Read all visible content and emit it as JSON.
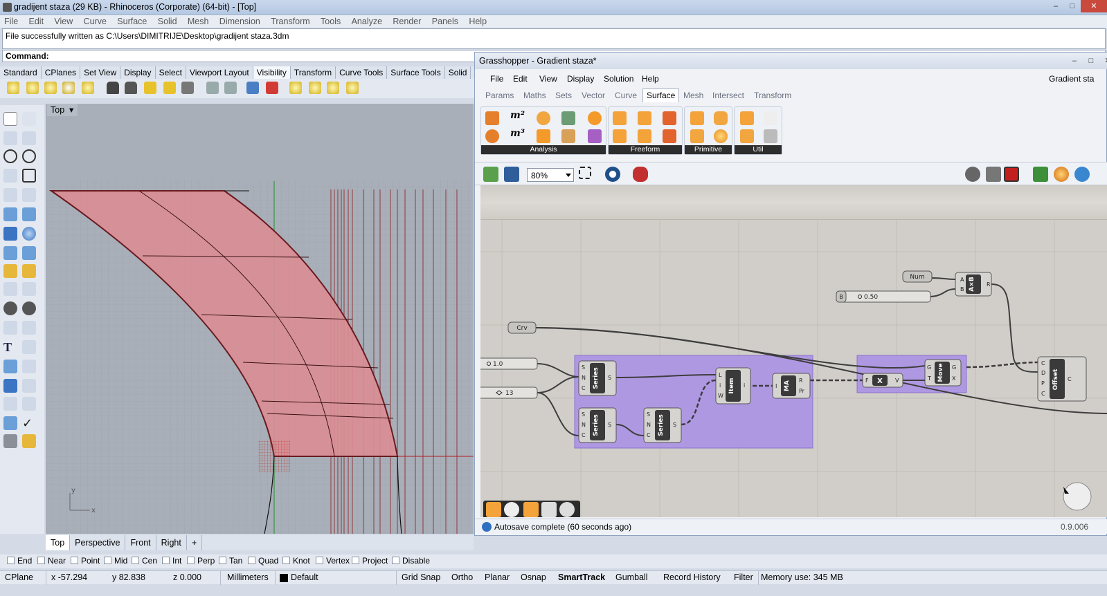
{
  "rhino": {
    "title": "gradijent staza (29 KB) - Rhinoceros (Corporate) (64-bit) - [Top]",
    "window_buttons": [
      "–",
      "□",
      "✕"
    ],
    "menu": [
      "File",
      "Edit",
      "View",
      "Curve",
      "Surface",
      "Solid",
      "Mesh",
      "Dimension",
      "Transform",
      "Tools",
      "Analyze",
      "Render",
      "Panels",
      "Help"
    ],
    "history_text": "File successfully written as C:\\Users\\DIMITRIJE\\Desktop\\gradijent staza.3dm",
    "command_label": "Command:",
    "toolbar_tabs": [
      "Standard",
      "CPlanes",
      "Set View",
      "Display",
      "Select",
      "Viewport Layout",
      "Visibility",
      "Transform",
      "Curve Tools",
      "Surface Tools",
      "Solid"
    ],
    "active_toolbar_tab": "Visibility",
    "viewport_title": "Top",
    "viewport_tabs": [
      "Top",
      "Perspective",
      "Front",
      "Right",
      "+"
    ],
    "axis_labels": {
      "y": "y",
      "x": "x"
    },
    "osnaps": [
      "End",
      "Near",
      "Point",
      "Mid",
      "Cen",
      "Int",
      "Perp",
      "Tan",
      "Quad",
      "Knot",
      "Vertex",
      "Project",
      "Disable"
    ],
    "status": {
      "cplane": "CPlane",
      "x": "x -57.294",
      "y": "y 82.838",
      "z": "z 0.000",
      "units": "Millimeters",
      "layer": "Default",
      "toggles": [
        "Grid Snap",
        "Ortho",
        "Planar",
        "Osnap",
        "SmartTrack",
        "Gumball",
        "Record History",
        "Filter"
      ],
      "memory": "Memory use: 345 MB"
    },
    "colors": {
      "surface_fill": "#d98e93",
      "surface_edge": "#6a1a20",
      "grid": "#9aa1ab",
      "titlebar": "#c9d8ec"
    }
  },
  "grasshopper": {
    "title": "Grasshopper - Gradient staza*",
    "menu": [
      "File",
      "Edit",
      "View",
      "Display",
      "Solution",
      "Help"
    ],
    "doc_name": "Gradient sta",
    "tabs": [
      "Params",
      "Maths",
      "Sets",
      "Vector",
      "Curve",
      "Surface",
      "Mesh",
      "Intersect",
      "Transform"
    ],
    "active_tab": "Surface",
    "ribbon_groups": [
      "Analysis",
      "Freeform",
      "Primitive",
      "Util"
    ],
    "zoom": "80%",
    "status": "Autosave complete (60 seconds ago)",
    "version": "0.9.006",
    "components": {
      "num": "Num",
      "crv": "Crv",
      "slider_b_tag": "B",
      "slider_b_value": "0.50",
      "slider_1_value": "1.0",
      "slider_2_value": "13",
      "axb": "A×B",
      "axb_inputs": [
        "A",
        "B"
      ],
      "axb_output": "R",
      "series": "Series",
      "series_inputs": [
        "S",
        "N",
        "C"
      ],
      "series_output": "S",
      "item": "Item",
      "item_inputs": [
        "L",
        "i",
        "W"
      ],
      "item_output": "i",
      "ma": "MA",
      "ma_input": "I",
      "ma_outputs": [
        "R",
        "Pr"
      ],
      "x": "X",
      "x_input": "F",
      "x_output": "V",
      "move": "Move",
      "move_inputs": [
        "G",
        "T"
      ],
      "move_outputs": [
        "G",
        "X"
      ],
      "offset": "Offset",
      "offset_inputs": [
        "C",
        "D",
        "P",
        "C"
      ],
      "offset_output": "C"
    },
    "colors": {
      "canvas": "#d1cec9",
      "group": "#a98ee6",
      "component": "#3a3a3a",
      "wire": "#3d3d3d"
    }
  }
}
